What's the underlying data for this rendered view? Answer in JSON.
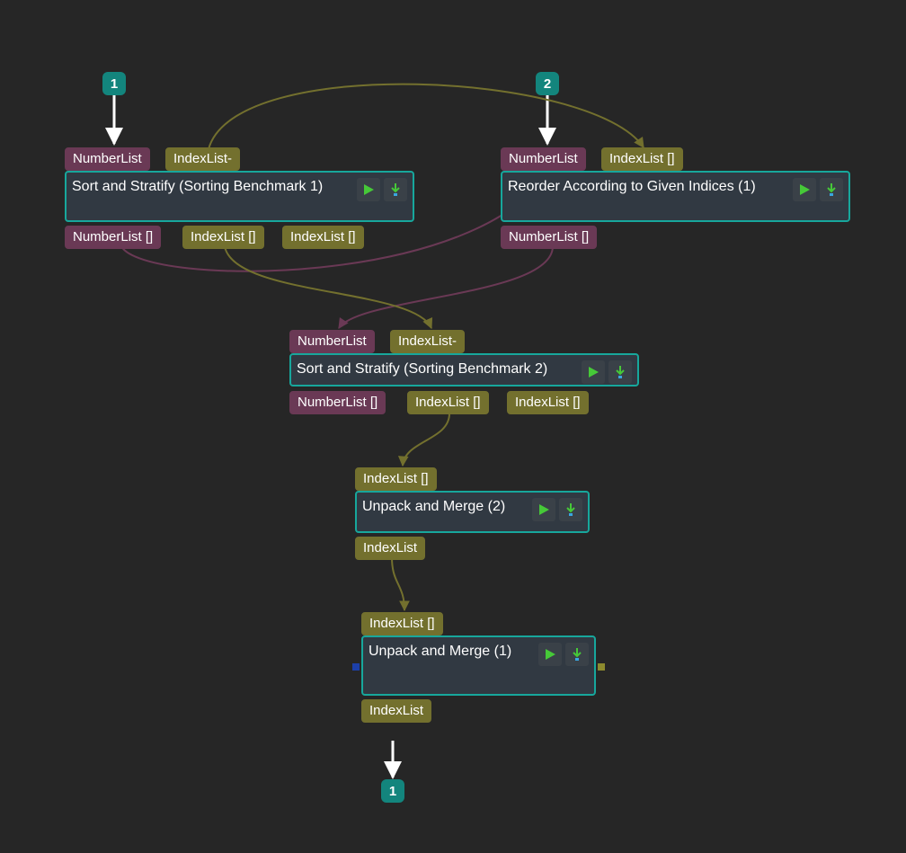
{
  "inputs": [
    "1",
    "2"
  ],
  "outputs": [
    "1"
  ],
  "nodes": [
    {
      "title": "Sort and Stratify (Sorting Benchmark 1)",
      "inputs": [
        "NumberList",
        "IndexList-"
      ],
      "outputs": [
        "NumberList []",
        "IndexList []",
        "IndexList []"
      ]
    },
    {
      "title": "Reorder According to Given Indices (1)",
      "inputs": [
        "NumberList",
        "IndexList []"
      ],
      "outputs": [
        "NumberList []"
      ]
    },
    {
      "title": "Sort and Stratify (Sorting Benchmark 2)",
      "inputs": [
        "NumberList",
        "IndexList-"
      ],
      "outputs": [
        "NumberList []",
        "IndexList []",
        "IndexList []"
      ]
    },
    {
      "title": "Unpack and Merge (2)",
      "inputs": [
        "IndexList []"
      ],
      "outputs": [
        "IndexList"
      ]
    },
    {
      "title": "Unpack and Merge (1)",
      "inputs": [
        "IndexList []"
      ],
      "outputs": [
        "IndexList"
      ]
    }
  ]
}
